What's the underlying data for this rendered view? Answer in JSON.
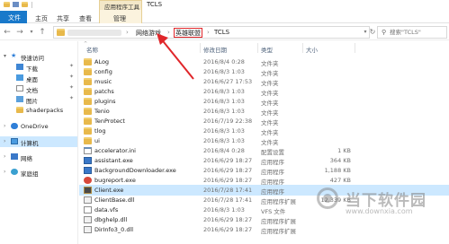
{
  "titlebar": {
    "context_tab": "应用程序工具",
    "window_title": "TCLS"
  },
  "ribbon": {
    "file_tab": "文件",
    "tabs": [
      "主页",
      "共享",
      "查看"
    ],
    "manage_tab": "管理"
  },
  "address": {
    "crumbs": [
      "网络游戏",
      "英雄联盟",
      "TCLS"
    ],
    "search_placeholder": "搜索\"TCLS\""
  },
  "sidebar": {
    "items": [
      {
        "label": "快速访问",
        "icon": "star-icon"
      },
      {
        "label": "下载",
        "icon": "download-icon"
      },
      {
        "label": "桌面",
        "icon": "desktop-icon"
      },
      {
        "label": "文档",
        "icon": "document-icon"
      },
      {
        "label": "图片",
        "icon": "pictures-icon"
      },
      {
        "label": "shaderpacks",
        "icon": "folder-icon"
      },
      {
        "label": "OneDrive",
        "icon": "cloud-icon"
      },
      {
        "label": "计算机",
        "icon": "computer-icon"
      },
      {
        "label": "网络",
        "icon": "network-icon"
      },
      {
        "label": "家庭组",
        "icon": "homegroup-icon"
      }
    ]
  },
  "columns": {
    "name": "名称",
    "date": "修改日期",
    "type": "类型",
    "size": "大小"
  },
  "files": [
    {
      "name": "ALog",
      "date": "2016/8/4 0:28",
      "type": "文件夹",
      "size": "",
      "kind": "folder"
    },
    {
      "name": "config",
      "date": "2016/8/3 1:03",
      "type": "文件夹",
      "size": "",
      "kind": "folder"
    },
    {
      "name": "music",
      "date": "2016/6/27 17:53",
      "type": "文件夹",
      "size": "",
      "kind": "folder"
    },
    {
      "name": "patchs",
      "date": "2016/8/3 1:03",
      "type": "文件夹",
      "size": "",
      "kind": "folder"
    },
    {
      "name": "plugins",
      "date": "2016/8/3 1:03",
      "type": "文件夹",
      "size": "",
      "kind": "folder"
    },
    {
      "name": "Tenio",
      "date": "2016/8/3 1:03",
      "type": "文件夹",
      "size": "",
      "kind": "folder"
    },
    {
      "name": "TenProtect",
      "date": "2016/7/19 22:38",
      "type": "文件夹",
      "size": "",
      "kind": "folder"
    },
    {
      "name": "tlog",
      "date": "2016/8/3 1:03",
      "type": "文件夹",
      "size": "",
      "kind": "folder"
    },
    {
      "name": "ui",
      "date": "2016/8/3 1:03",
      "type": "文件夹",
      "size": "",
      "kind": "folder"
    },
    {
      "name": "accelerator.ini",
      "date": "2016/8/4 0:28",
      "type": "配置设置",
      "size": "1 KB",
      "kind": "ini"
    },
    {
      "name": "assistant.exe",
      "date": "2016/6/29 18:27",
      "type": "应用程序",
      "size": "364 KB",
      "kind": "exe"
    },
    {
      "name": "BackgroundDownloader.exe",
      "date": "2016/6/29 18:27",
      "type": "应用程序",
      "size": "1,188 KB",
      "kind": "exe"
    },
    {
      "name": "bugreport.exe",
      "date": "2016/6/29 18:27",
      "type": "应用程序",
      "size": "427 KB",
      "kind": "bug"
    },
    {
      "name": "Client.exe",
      "date": "2016/7/28 17:41",
      "type": "应用程序",
      "size": "",
      "kind": "lol"
    },
    {
      "name": "ClientBase.dll",
      "date": "2016/7/28 17:41",
      "type": "应用程序扩展",
      "size": "12,339 KB",
      "kind": "dll"
    },
    {
      "name": "data.vfs",
      "date": "2016/8/3 1:03",
      "type": "VFS 文件",
      "size": "",
      "kind": "file"
    },
    {
      "name": "dbghelp.dll",
      "date": "2016/6/29 18:27",
      "type": "应用程序扩展",
      "size": "",
      "kind": "dll"
    },
    {
      "name": "DirInfo3_0.dll",
      "date": "2016/6/29 18:27",
      "type": "应用程序扩展",
      "size": "",
      "kind": "dll"
    }
  ],
  "watermark": {
    "title": "当下软件园",
    "url": "www.downxia.com"
  },
  "colors": {
    "file_tab": "#1979ca",
    "selection": "#cce8ff",
    "annotation_red": "#e0262a",
    "context_tab": "#f3e7c8"
  }
}
